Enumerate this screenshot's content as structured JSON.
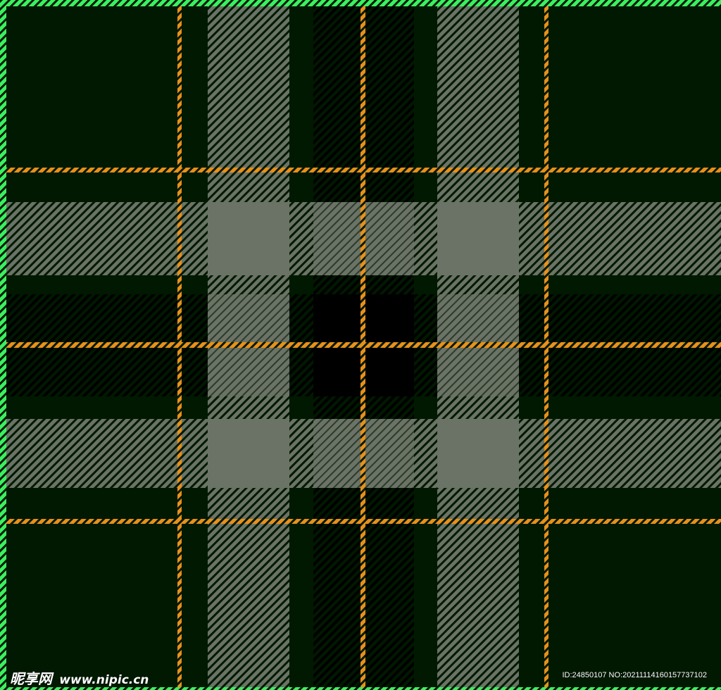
{
  "image": {
    "description_colors": {
      "base_green": "#001900",
      "grey_band": "#6b7366",
      "black": "#000000",
      "orange_line": "#e8901c",
      "bright_green_border": "#3cf060"
    }
  },
  "watermark": {
    "site_name": "昵享网",
    "site_url": "www.nipic.cn",
    "id_text": "ID:24850107 NO:20211114160157737102"
  }
}
